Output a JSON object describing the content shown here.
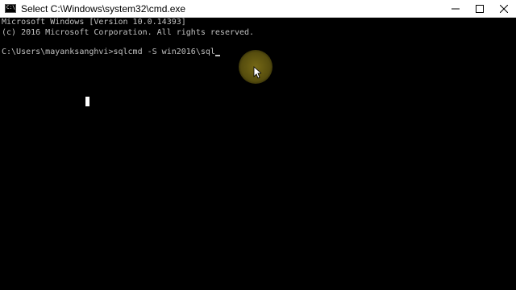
{
  "window": {
    "title": "Select C:\\Windows\\system32\\cmd.exe",
    "icon_text": "C:\\",
    "icon": "cmd-icon",
    "controls": {
      "minimize_icon": "minimize-icon",
      "maximize_icon": "maximize-icon",
      "close_icon": "close-icon"
    }
  },
  "console": {
    "lines": [
      "Microsoft Windows [Version 10.0.14393]",
      "(c) 2016 Microsoft Corporation. All rights reserved.",
      "",
      "C:\\Users\\mayanksanghvi>sqlcmd -S win2016\\sql"
    ],
    "background": "#000000",
    "foreground": "#c0c0c0"
  },
  "pointer": {
    "icon": "mouse-pointer-icon",
    "highlight_color": "#d6be28"
  }
}
